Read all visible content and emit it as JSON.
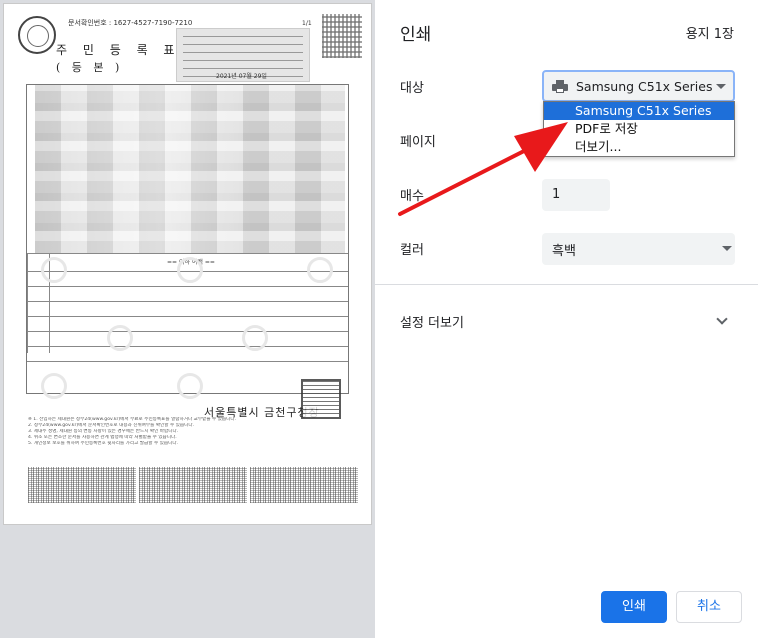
{
  "preview": {
    "doc_confirm_no": "문서확인번호 : 1627-4527-7190-7210",
    "page_num": "1/1",
    "title": "주 민 등 록 표",
    "subtitle": "( 등     본 )",
    "date": "2021년 07월 29일",
    "end_mark": "== 이하 여백 ==",
    "issuer": "서울특별시 금천구청장",
    "notes": [
      "※ 1. 전입하는 세대원은 정부24(www.gov.kr)에서 무료로 주민등록표를 열람하거나 교부받을 수 있습니다.",
      "  2. 정부24(www.gov.kr)에서 문서확인번호로 내용과 진위여부를 확인할 수 있습니다.",
      "  3. 세대주 성명, 세대원 등의 변동 사항이 있는 경우에는 반드시 확인 바랍니다.",
      "  4. 위조 또는 변조한 문서를 사용하면 관계 법령에 따라 처벌받을 수 있습니다.",
      "  5. 개인정보 보호를 위하여 주민등록번호 뒷자리를 가리고 발급할 수 있습니다."
    ]
  },
  "settings": {
    "title": "인쇄",
    "sheets": "용지 1장",
    "destination_label": "대상",
    "destination_value": "Samsung C51x Series",
    "destination_icon": "printer-icon",
    "dropdown_options": [
      "Samsung C51x Series",
      "PDF로 저장",
      "더보기..."
    ],
    "dropdown_selected_index": 0,
    "pages_label": "페이지",
    "copies_label": "매수",
    "copies_value": "1",
    "color_label": "컬러",
    "color_value": "흑백",
    "more_settings_label": "설정 더보기",
    "print_button": "인쇄",
    "cancel_button": "취소"
  },
  "colors": {
    "accent": "#1a73e8",
    "dropdown_selected": "#1e6fd9",
    "annotation_arrow": "#e8191b",
    "preview_background": "#dadce0"
  }
}
